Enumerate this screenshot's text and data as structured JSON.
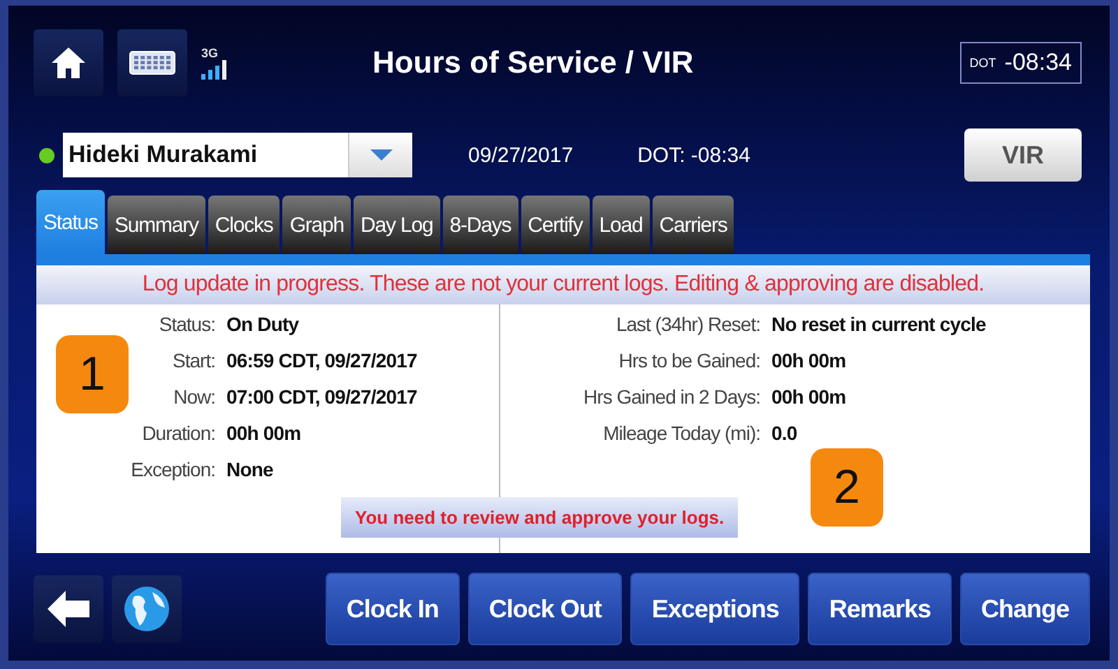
{
  "window": {
    "title": "Hours of Service / VIR"
  },
  "network": {
    "label": "3G"
  },
  "dot_clock": {
    "label": "DOT",
    "value": "-08:34"
  },
  "driver": {
    "name": "Hideki Murakami",
    "online": true
  },
  "date": "09/27/2017",
  "dot_status": "DOT: -08:34",
  "vir_button": "VIR",
  "tabs": [
    {
      "label": "Status",
      "selected": true
    },
    {
      "label": "Summary",
      "selected": false
    },
    {
      "label": "Clocks",
      "selected": false
    },
    {
      "label": "Graph",
      "selected": false
    },
    {
      "label": "Day Log",
      "selected": false
    },
    {
      "label": "8-Days",
      "selected": false
    },
    {
      "label": "Certify",
      "selected": false
    },
    {
      "label": "Load",
      "selected": false
    },
    {
      "label": "Carriers",
      "selected": false
    }
  ],
  "warning": "Log update in progress. These are not your current logs.  Editing & approving are disabled.",
  "left_fields": [
    {
      "label": "Status:",
      "value": "On Duty"
    },
    {
      "label": "Start:",
      "value": "06:59 CDT, 09/27/2017"
    },
    {
      "label": "Now:",
      "value": "07:00 CDT, 09/27/2017"
    },
    {
      "label": "Duration:",
      "value": "00h 00m"
    },
    {
      "label": "Exception:",
      "value": "None"
    }
  ],
  "right_fields": [
    {
      "label": "Last (34hr) Reset:",
      "value": "No reset in current cycle"
    },
    {
      "label": "Hrs to be Gained:",
      "value": "00h 00m"
    },
    {
      "label": "Hrs Gained in 2 Days:",
      "value": "00h 00m"
    },
    {
      "label": "Mileage Today (mi):",
      "value": "0.0"
    }
  ],
  "review_notice": "You need to review and approve your logs.",
  "callouts": [
    "1",
    "2"
  ],
  "buttons": [
    "Clock In",
    "Clock Out",
    "Exceptions",
    "Remarks",
    "Change"
  ]
}
